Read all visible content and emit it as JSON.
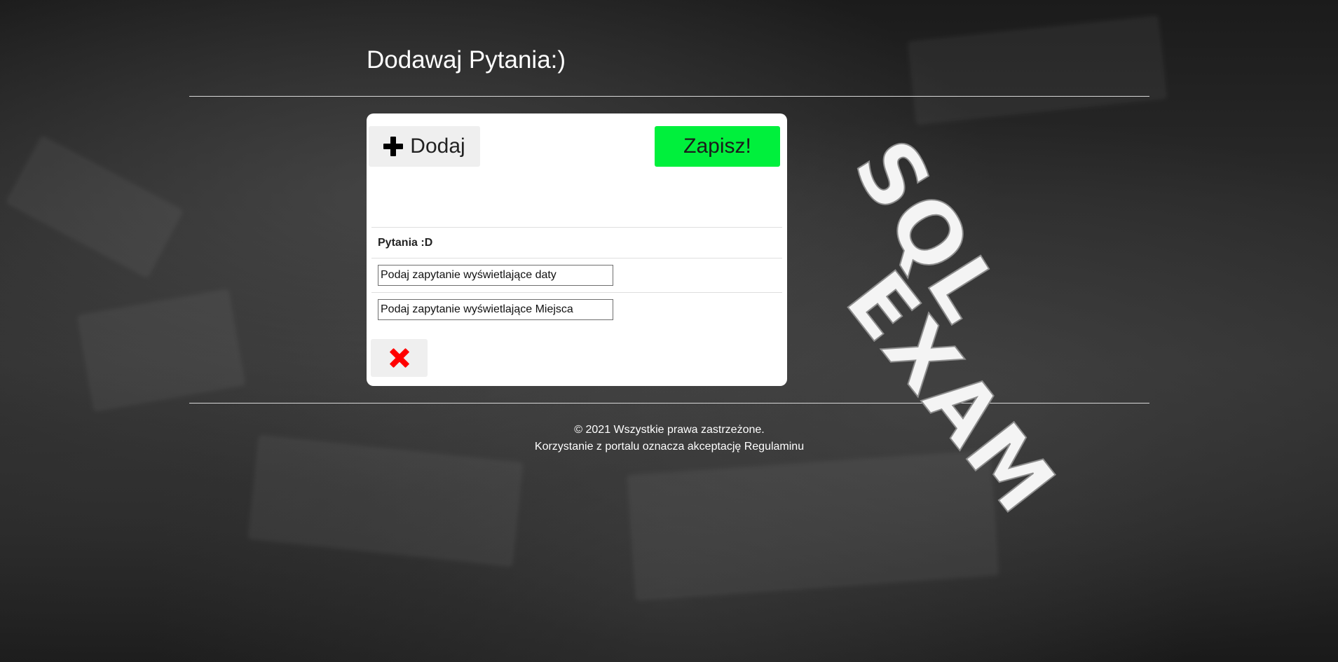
{
  "header": {
    "title": "Dodawaj Pytania:)"
  },
  "toolbar": {
    "add_label": "Dodaj",
    "save_label": "Zapisz!"
  },
  "questions": {
    "header": "Pytania :D",
    "items": [
      {
        "value": "Podaj zapytanie wyświetlające daty"
      },
      {
        "value": "Podaj zapytanie wyświetlające Miejsca"
      }
    ]
  },
  "footer": {
    "copyright": "© 2021 Wszystkie prawa zastrzeżone.",
    "terms": "Korzystanie z portalu oznacza akceptację Regulaminu"
  },
  "logo": {
    "text_top": "SQL",
    "text_bottom": "EXAM"
  },
  "colors": {
    "save_button_bg": "#00f03c",
    "delete_icon": "#ff0000",
    "panel_bg": "#ffffff"
  },
  "icons": {
    "add": "plus-icon",
    "delete": "close-icon"
  }
}
